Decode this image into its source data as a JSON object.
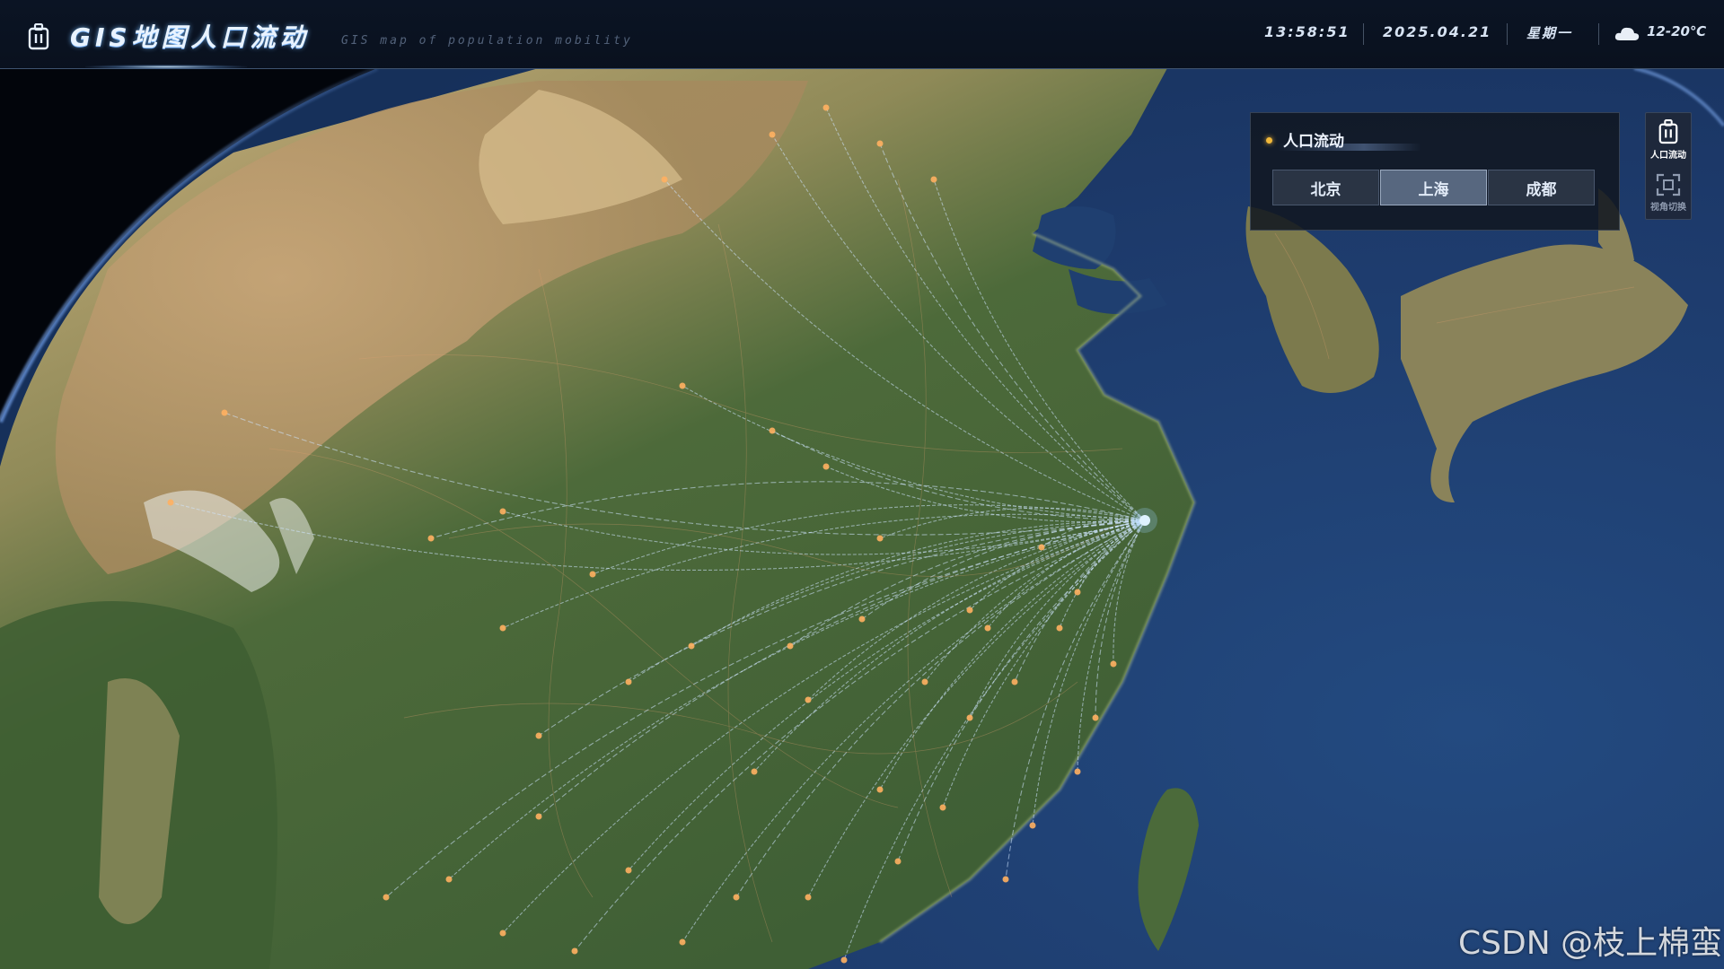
{
  "header": {
    "title": "GIS地图人口流动",
    "subtitle": "GIS map of population mobility",
    "time": "13:58:51",
    "date": "2025.04.21",
    "weekday": "星期一",
    "weather_icon": "cloud-icon",
    "temperature": "12-20℃"
  },
  "panel": {
    "title": "人口流动",
    "city_tabs": [
      {
        "label": "北京",
        "active": false
      },
      {
        "label": "上海",
        "active": true
      },
      {
        "label": "成都",
        "active": false
      }
    ]
  },
  "side_toolbar": {
    "items": [
      {
        "label": "人口流动",
        "icon": "population-flow-icon",
        "active": true
      },
      {
        "label": "视角切换",
        "icon": "view-switch-icon",
        "active": false
      }
    ]
  },
  "map": {
    "source_city": "上海",
    "flow_line_color": "#cfe6ff",
    "ocean_color": "#1d3a6b",
    "land_color": "#566d3e"
  },
  "watermark": "CSDN @枝上棉蛮"
}
